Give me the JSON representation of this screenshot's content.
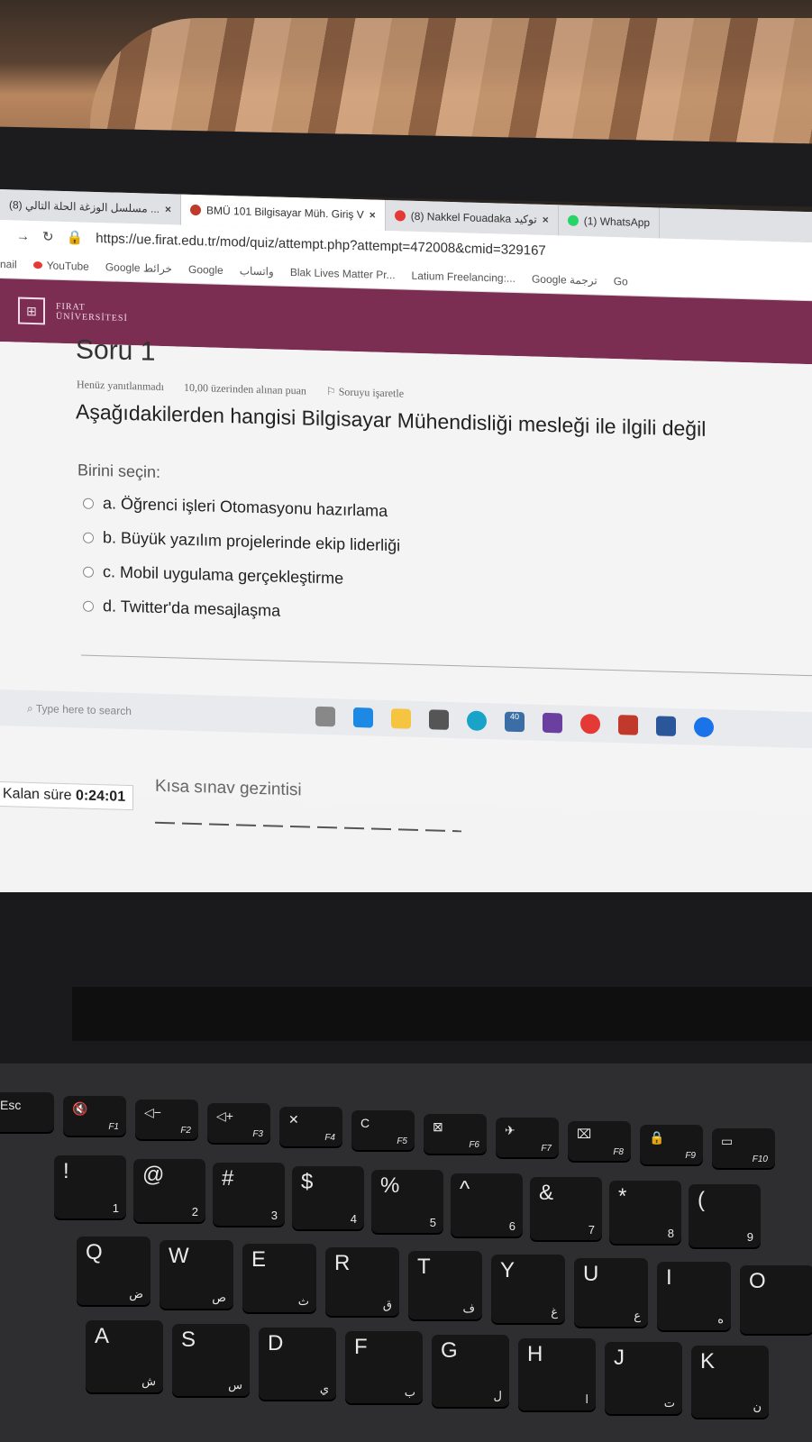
{
  "browser": {
    "tabs": [
      {
        "label": "(8) مسلسل الوزغة الحلة التالي ...",
        "close": "×"
      },
      {
        "label": "BMÜ 101 Bilgisayar Müh. Giriş V",
        "close": "×"
      },
      {
        "label": "(8) Nakkel Fouadaka توكيد",
        "close": "×"
      },
      {
        "label": "(1) WhatsApp",
        "close": ""
      }
    ],
    "url": "https://ue.firat.edu.tr/mod/quiz/attempt.php?attempt=472008&cmid=329167",
    "bookmarks": [
      "nail",
      "YouTube",
      "Google خرائط",
      "Google",
      "واتساب",
      "Blak Lives Matter Pr...",
      "Latium Freelancing:...",
      "Google ترجمة",
      "Go"
    ]
  },
  "site": {
    "logo_text_1": "FIRAT",
    "logo_text_2": "ÜNİVERSİTESİ"
  },
  "quiz": {
    "title": "Soru 1",
    "status": "Henüz yanıtlanmadı",
    "points": "10,00 üzerinden alınan puan",
    "flag": "Soruyu işaretle",
    "question": "Aşağıdakilerden hangisi Bilgisayar Mühendisliği mesleği ile ilgili değil",
    "prompt": "Birini seçin:",
    "options": [
      "a. Öğrenci işleri Otomasyonu hazırlama",
      "b. Büyük yazılım projelerinde ekip liderliği",
      "c. Mobil uygulama gerçekleştirme",
      "d. Twitter'da mesajlaşma"
    ],
    "timer_label": "Kalan süre",
    "timer_value": "0:24:01",
    "nav_label": "Kısa sınav gezintisi"
  },
  "taskbar": {
    "search_placeholder": "Type here to search",
    "badge": "40"
  },
  "keyboard": {
    "fkeys": [
      [
        "Esc",
        ""
      ],
      [
        "🔇",
        "F1"
      ],
      [
        "◁−",
        "F2"
      ],
      [
        "◁+",
        "F3"
      ],
      [
        "✕",
        "F4"
      ],
      [
        "C",
        "F5"
      ],
      [
        "⊠",
        "F6"
      ],
      [
        "✈",
        "F7"
      ],
      [
        "⌧",
        "F8"
      ],
      [
        "🔒",
        "F9"
      ],
      [
        "▭",
        "F10"
      ]
    ],
    "numrow": [
      [
        "!",
        "1"
      ],
      [
        "@",
        "2"
      ],
      [
        "#",
        "3"
      ],
      [
        "$",
        "4"
      ],
      [
        "%",
        "5"
      ],
      [
        "^",
        "6"
      ],
      [
        "&",
        "7"
      ],
      [
        "*",
        "8"
      ],
      [
        "(",
        "9"
      ]
    ],
    "qrow": [
      [
        "Q",
        "ض"
      ],
      [
        "W",
        "ص"
      ],
      [
        "E",
        "ث"
      ],
      [
        "R",
        "ق"
      ],
      [
        "T",
        "ف"
      ],
      [
        "Y",
        "غ"
      ],
      [
        "U",
        "ع"
      ],
      [
        "I",
        "ه"
      ],
      [
        "O",
        ""
      ]
    ],
    "arow": [
      [
        "A",
        "ش"
      ],
      [
        "S",
        "س"
      ],
      [
        "D",
        "ي"
      ],
      [
        "F",
        "ب"
      ],
      [
        "G",
        "ل"
      ],
      [
        "H",
        "ا"
      ],
      [
        "J",
        "ت"
      ],
      [
        "K",
        "ن"
      ]
    ]
  }
}
